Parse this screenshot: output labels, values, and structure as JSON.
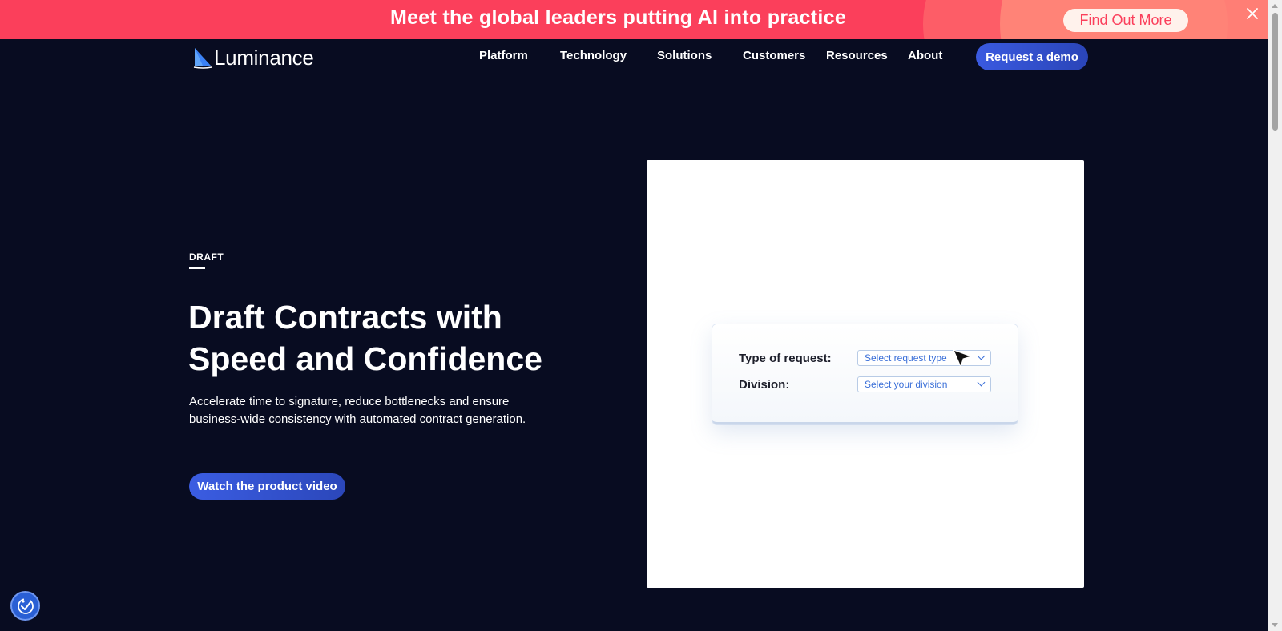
{
  "banner": {
    "text": "Meet the global leaders putting AI into practice",
    "cta_label": "Find Out More",
    "close_icon": "close-icon"
  },
  "header": {
    "logo_text": "Luminance",
    "logo_icon": "sail-logo-icon",
    "nav": [
      "Platform",
      "Technology",
      "Solutions",
      "Customers",
      "Resources",
      "About"
    ],
    "cta_label": "Request a demo"
  },
  "hero": {
    "eyebrow": "DRAFT",
    "title_lines": [
      "Draft Contracts with",
      "Speed and Confidence"
    ],
    "subtitle_lines": [
      "Accelerate time to signature, reduce bottlenecks and ensure",
      "business-wide consistency with automated contract generation."
    ],
    "cta_label": "Watch the product video"
  },
  "product_visual": {
    "fields": [
      {
        "label": "Type of request:",
        "value": "Select request type"
      },
      {
        "label": "Division:",
        "value": "Select your division"
      }
    ],
    "cursor_icon": "mouse-pointer-icon"
  },
  "accessibility": {
    "icon": "accessibility-icon"
  },
  "colors": {
    "background": "#080c21",
    "banner": "#fb3f5b",
    "accent": "#3a5ae0",
    "banner_cta_text": "#fb3f5b"
  }
}
